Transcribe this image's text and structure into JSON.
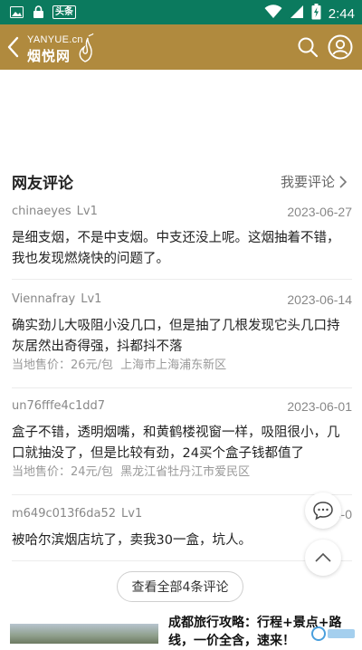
{
  "status_bar": {
    "news_badge": "头条",
    "time": "2:44"
  },
  "header": {
    "logo_en": "YANYUE.cn",
    "logo_cn": "烟悦网",
    "accent_color": "#b08a3e"
  },
  "reviews": {
    "title": "网友评论",
    "action": "我要评论",
    "items": [
      {
        "user": "chinaeyes",
        "level": "Lv1",
        "date": "2023-06-27",
        "text": "是细支烟，不是中支烟。中支还没上呢。这烟抽着不错，我也发现燃烧快的问题了。",
        "price": "",
        "location": ""
      },
      {
        "user": "Viennafray",
        "level": "Lv1",
        "date": "2023-06-14",
        "text": "确实劲儿大吸阻小没几口，但是抽了几根发现它头几口持灰居然出奇得强，抖都抖不落",
        "price": "当地售价：26元/包",
        "location": "上海市上海浦东新区"
      },
      {
        "user": "un76fffe4c1dd7",
        "level": "",
        "date": "2023-06-01",
        "text": "盒子不错，透明烟嘴，和黄鹤楼视窗一样，吸阻很小，几口就抽没了，但是比较有劲，24买个盒子钱都值了",
        "price": "当地售价：24元/包",
        "location": "黑龙江省牡丹江市爱民区"
      },
      {
        "user": "m649c013f6da52",
        "level": "Lv1",
        "date": "2023-0",
        "text": "被哈尔滨烟店坑了，卖我30一盒，坑人。",
        "price": "",
        "location": ""
      }
    ],
    "view_all": "查看全部4条评论"
  },
  "article": {
    "title": "成都旅行攻略：行程+景点+路线，一价全含，速来！"
  },
  "icons": {
    "back": "chevron-left-icon",
    "search": "search-icon",
    "user": "user-icon",
    "chat": "chat-icon",
    "top": "chevron-up-icon"
  }
}
